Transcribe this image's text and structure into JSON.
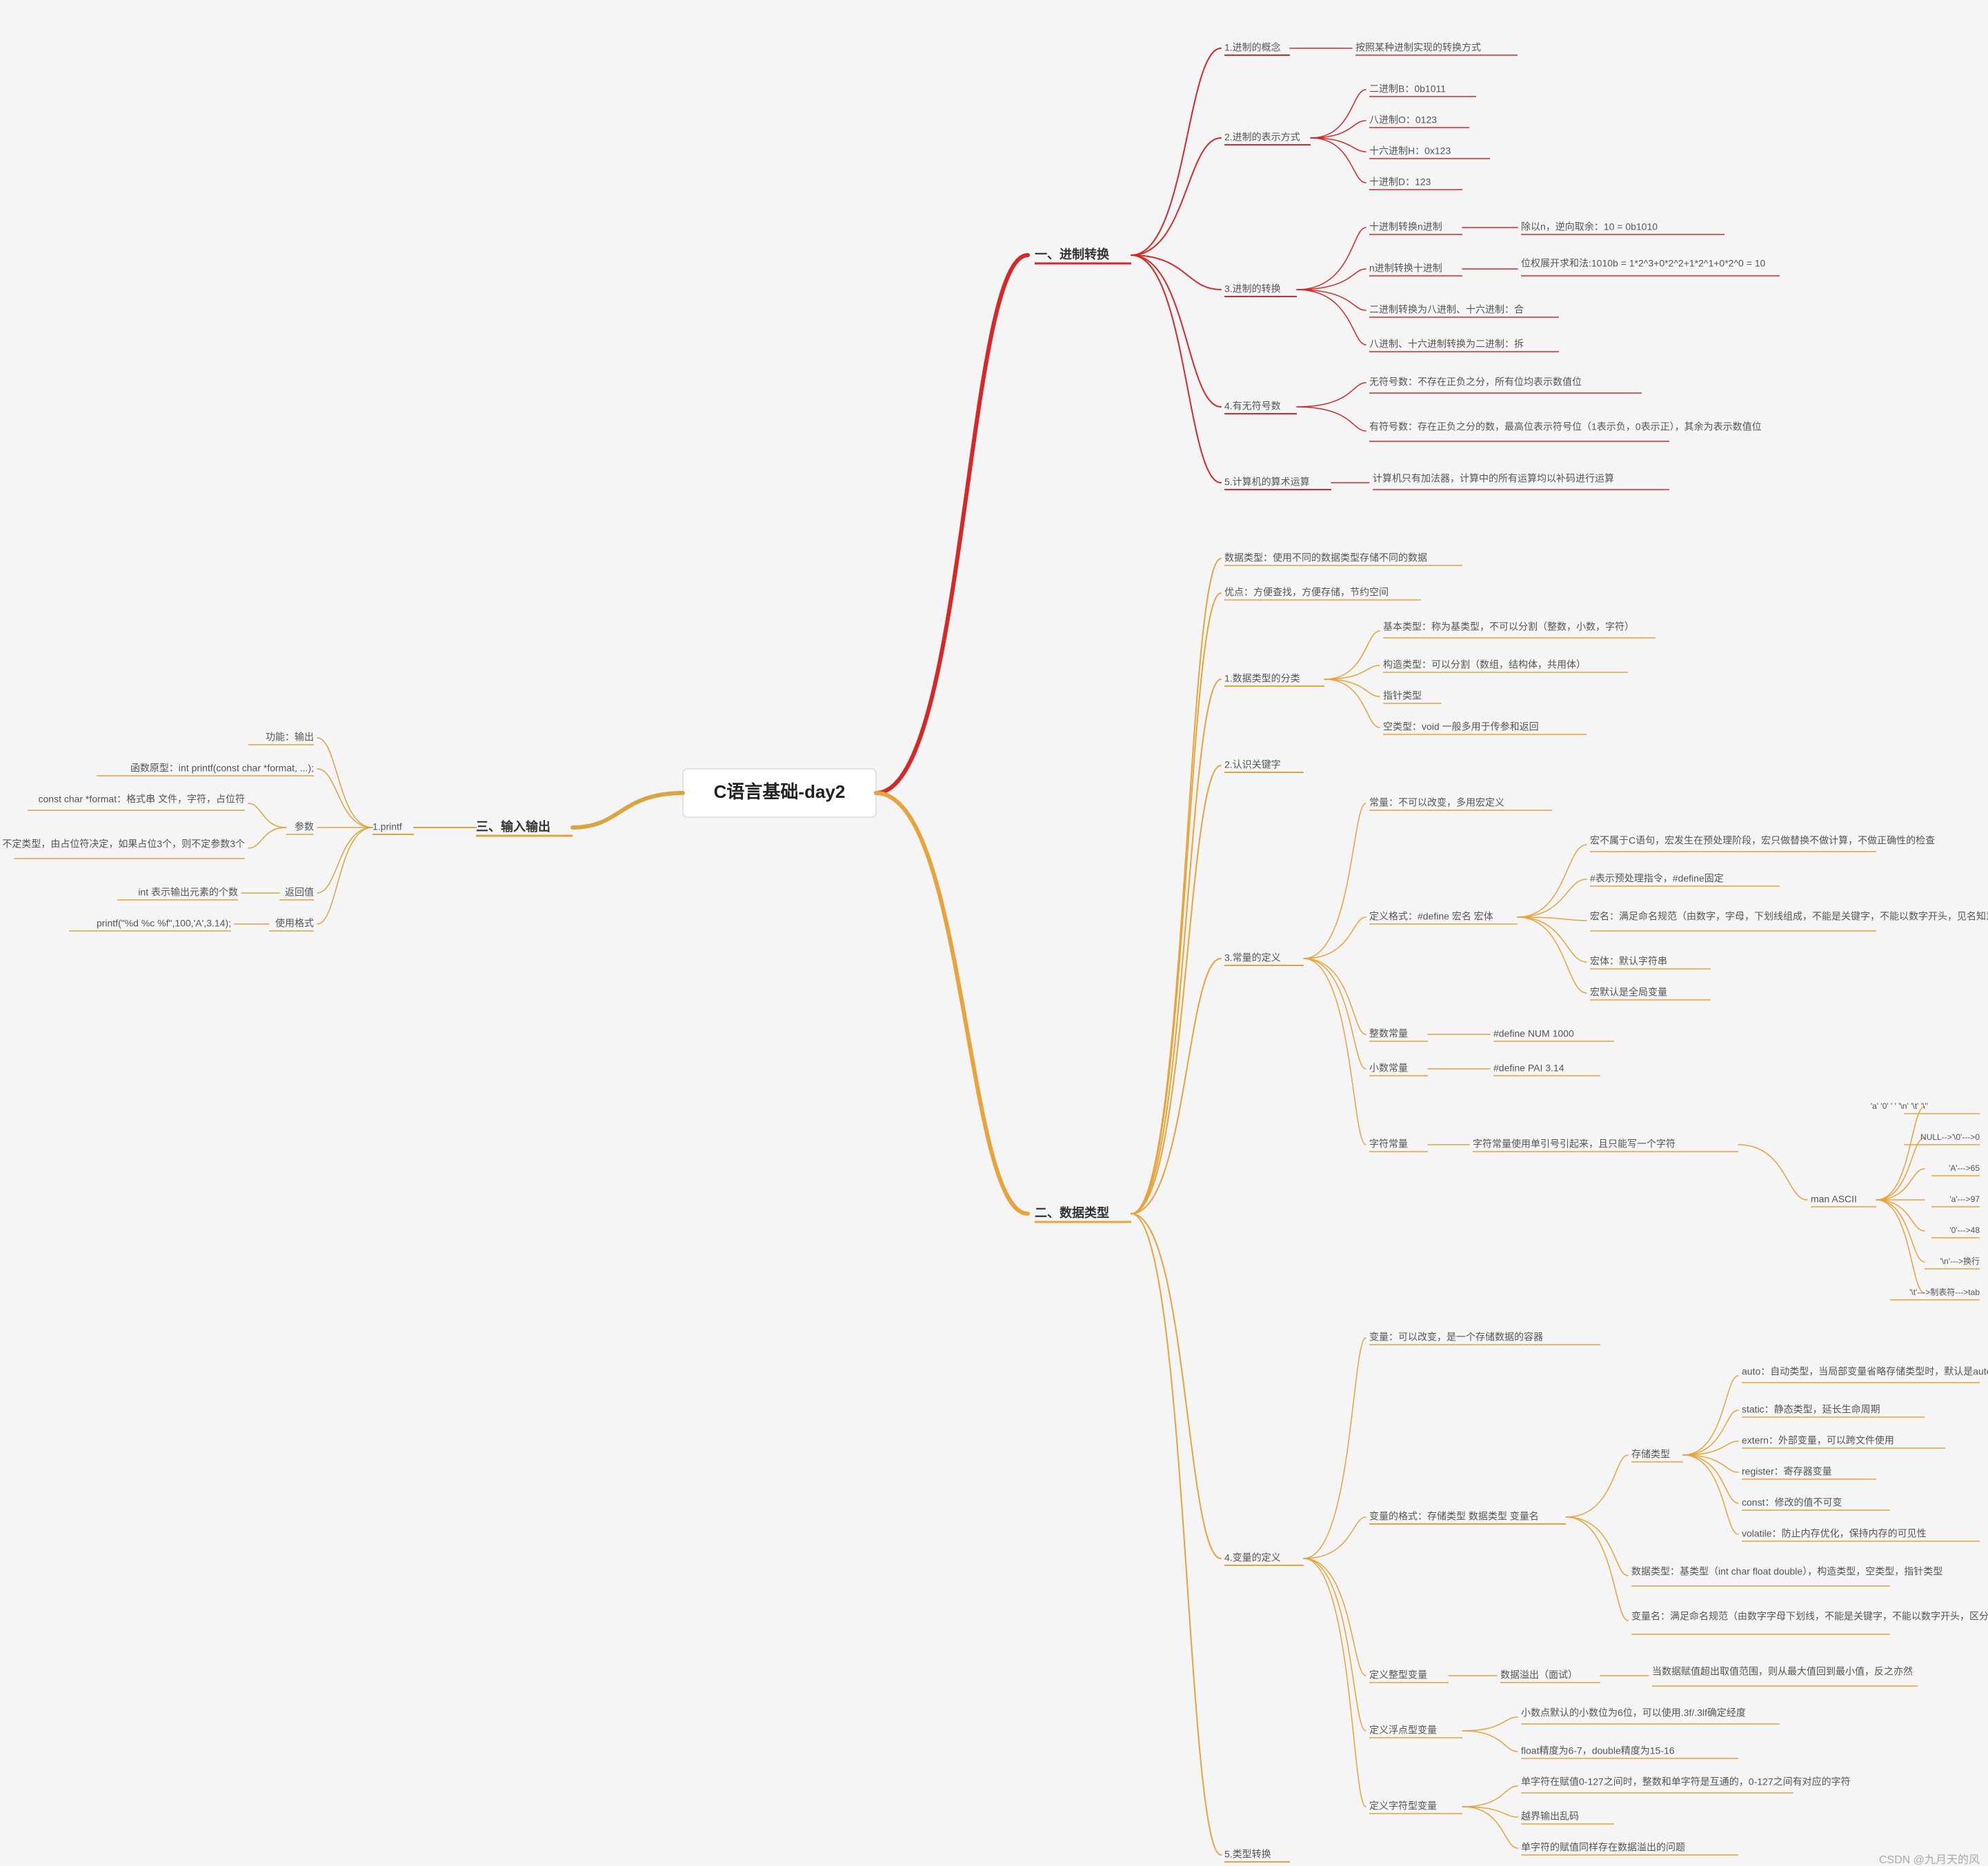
{
  "root": "C语言基础-day2",
  "watermark": "CSDN @九月天的风",
  "b1": {
    "title": "一、进制转换",
    "n1": {
      "lbl": "1.进制的概念",
      "d": "按照某种进制实现的转换方式"
    },
    "n2": {
      "lbl": "2.进制的表示方式",
      "a": "二进制B：0b1011",
      "b": "八进制O：0123",
      "c": "十六进制H：0x123",
      "d": "十进制D：123"
    },
    "n3": {
      "lbl": "3.进制的转换",
      "a": {
        "lbl": "十进制转换n进制",
        "d": "除以n，逆向取余：10 = 0b1010"
      },
      "b": {
        "lbl": "n进制转换十进制",
        "d": "位权展开求和法:1010b = 1*2^3+0*2^2+1*2^1+0*2^0 = 10"
      },
      "c": "二进制转换为八进制、十六进制：合",
      "d": "八进制、十六进制转换为二进制：拆"
    },
    "n4": {
      "lbl": "4.有无符号数",
      "a": "无符号数：不存在正负之分，所有位均表示数值位",
      "b": "有符号数：存在正负之分的数，最高位表示符号位（1表示负，0表示正），其余为表示数值位"
    },
    "n5": {
      "lbl": "5.计算机的算术运算",
      "d": "计算机只有加法器，计算中的所有运算均以补码进行运算"
    }
  },
  "b2": {
    "title": "二、数据类型",
    "t1": "数据类型：使用不同的数据类型存储不同的数据",
    "t2": "优点：方便查找，方便存储，节约空间",
    "n1": {
      "lbl": "1.数据类型的分类",
      "a": "基本类型：称为基类型，不可以分割（整数，小数，字符）",
      "b": "构造类型：可以分割（数组，结构体，共用体）",
      "c": "指针类型",
      "d": "空类型：void 一般多用于传参和返回"
    },
    "n2": {
      "lbl": "2.认识关键字"
    },
    "n3": {
      "lbl": "3.常量的定义",
      "a": "常量：不可以改变，多用宏定义",
      "fmt": {
        "lbl": "定义格式：#define 宏名 宏体",
        "a": "宏不属于C语句，宏发生在预处理阶段，宏只做替换不做计算，不做正确性的检查",
        "b": "#表示预处理指令，#define固定",
        "c": "宏名：满足命名规范（由数字，字母，下划线组成，不能是关键字，不能以数字开头，见名知意），一般建议宏名大写",
        "d": "宏体：默认字符串",
        "e": "宏默认是全局变量"
      },
      "int": {
        "lbl": "整数常量",
        "d": "#define NUM 1000"
      },
      "flt": {
        "lbl": "小数常量",
        "d": "#define PAI 3.14"
      },
      "chr": {
        "lbl": "字符常量",
        "d": "字符常量使用单引号引起来，且只能写一个字符",
        "ascii": {
          "lbl": "man ASCII",
          "a": "'a'  '0'  ' '  '\\n'  '\\t'  '\\''",
          "b": "NULL-->'\\0'--->0",
          "c": "'A'--->65",
          "d": "'a'--->97",
          "e": "'0'--->48",
          "f": "'\\n'--->换行",
          "g": "'\\t'--->制表符--->tab"
        }
      }
    },
    "n4": {
      "lbl": "4.变量的定义",
      "a": "变量：可以改变，是一个存储数据的容器",
      "fmt": {
        "lbl": "变量的格式：存储类型 数据类型 变量名",
        "store": {
          "lbl": "存储类型",
          "a": "auto：自动类型，当局部变量省略存储类型时，默认是auto",
          "b": "static：静态类型，延长生命周期",
          "c": "extern：外部变量，可以跨文件使用",
          "d": "register：寄存器变量",
          "e": "const：修改的值不可变",
          "f": "volatile：防止内存优化，保持内存的可见性"
        },
        "dt": "数据类型：基类型（int char float double），构造类型，空类型，指针类型",
        "nm": "变量名：满足命名规范（由数字字母下划线，不能是关键字，不能以数字开头，区分大小写，见名知意）"
      },
      "int": {
        "lbl": "定义整型变量",
        "o": {
          "lbl": "数据溢出（面试）",
          "d": "当数据赋值超出取值范围，则从最大值回到最小值，反之亦然"
        }
      },
      "flt": {
        "lbl": "定义浮点型变量",
        "a": "小数点默认的小数位为6位，可以使用.3f/.3lf确定经度",
        "b": "float精度为6-7，double精度为15-16"
      },
      "chr": {
        "lbl": "定义字符型变量",
        "a": "单字符在赋值0-127之间时，整数和单字符是互通的，0-127之间有对应的字符",
        "b": "越界输出乱码",
        "c": "单字符的赋值同样存在数据溢出的问题"
      }
    },
    "n5": {
      "lbl": "5.类型转换"
    }
  },
  "b3": {
    "title": "三、输入输出",
    "p": {
      "lbl": "1.printf",
      "fn": {
        "lbl": "功能",
        "d": "功能：输出"
      },
      "proto": {
        "lbl": "函数原型",
        "d": "函数原型：int printf(const char *format, ...);"
      },
      "param": {
        "lbl": "参数",
        "a": "const char *format：格式串    文件，字符，占位符",
        "b": "...：不定参数，不定个数，不定类型，由占位符决定，如果占位3个，则不定参数3个"
      },
      "ret": {
        "lbl": "返回值",
        "d": "int 表示输出元素的个数"
      },
      "use": {
        "lbl": "使用格式",
        "d": "printf(\"%d %c %f\",100,'A',3.14);"
      }
    }
  }
}
